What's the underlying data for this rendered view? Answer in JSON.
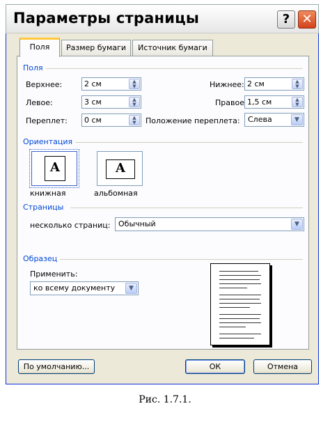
{
  "window": {
    "title": "Параметры страницы"
  },
  "tabs": [
    {
      "label": "Поля"
    },
    {
      "label": "Размер бумаги"
    },
    {
      "label": "Источник бумаги"
    }
  ],
  "margins": {
    "group_title": "Поля",
    "top": {
      "label": "Верхнее:",
      "value": "2 см"
    },
    "bottom": {
      "label": "Нижнее:",
      "value": "2 см"
    },
    "left": {
      "label": "Левое:",
      "value": "3 см"
    },
    "right": {
      "label": "Правое:",
      "value": "1,5 см"
    },
    "gutter": {
      "label": "Переплет:",
      "value": "0 см"
    },
    "gutter_position": {
      "label": "Положение переплета:",
      "value": "Слева"
    }
  },
  "orientation": {
    "group_title": "Ориентация",
    "portrait_label": "книжная",
    "landscape_label": "альбомная",
    "glyph": "A"
  },
  "pages": {
    "group_title": "Страницы",
    "multiple_label": "несколько страниц:",
    "multiple_value": "Обычный"
  },
  "sample": {
    "group_title": "Образец",
    "apply_label": "Применить:",
    "apply_value": "ко всему документу"
  },
  "buttons": {
    "default": "По умолчанию...",
    "ok": "ОК",
    "cancel": "Отмена"
  },
  "caption": "Рис. 1.7.1."
}
